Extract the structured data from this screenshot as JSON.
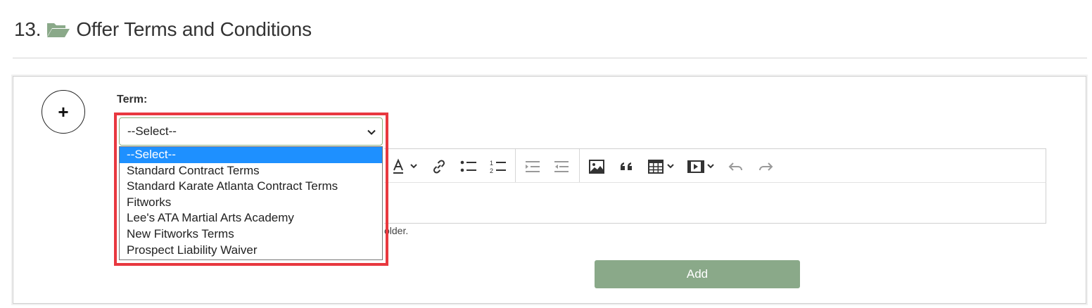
{
  "section": {
    "number": "13.",
    "title": "Offer Terms and Conditions"
  },
  "form": {
    "term_label": "Term:",
    "select_value": "--Select--",
    "options": [
      "--Select--",
      "Standard Contract Terms",
      "Standard Karate Atlanta Contract Terms",
      "Fitworks",
      "Lee's ATA Martial Arts Academy",
      "New Fitworks Terms",
      "Prospect Liability Waiver"
    ],
    "selected_option_index": 0,
    "helper_text_visible": "older.",
    "add_label": "Add"
  },
  "toolbar": {
    "icons": [
      "font-color-icon",
      "link-icon",
      "bulleted-list-icon",
      "numbered-list-icon",
      "indent-icon",
      "outdent-icon",
      "image-icon",
      "blockquote-icon",
      "table-icon",
      "media-icon",
      "undo-icon",
      "redo-icon"
    ]
  },
  "colors": {
    "highlight": "#e8383f",
    "selected_option": "#1e90ff",
    "add_button": "#8aa989",
    "folder_icon": "#8aa989"
  }
}
